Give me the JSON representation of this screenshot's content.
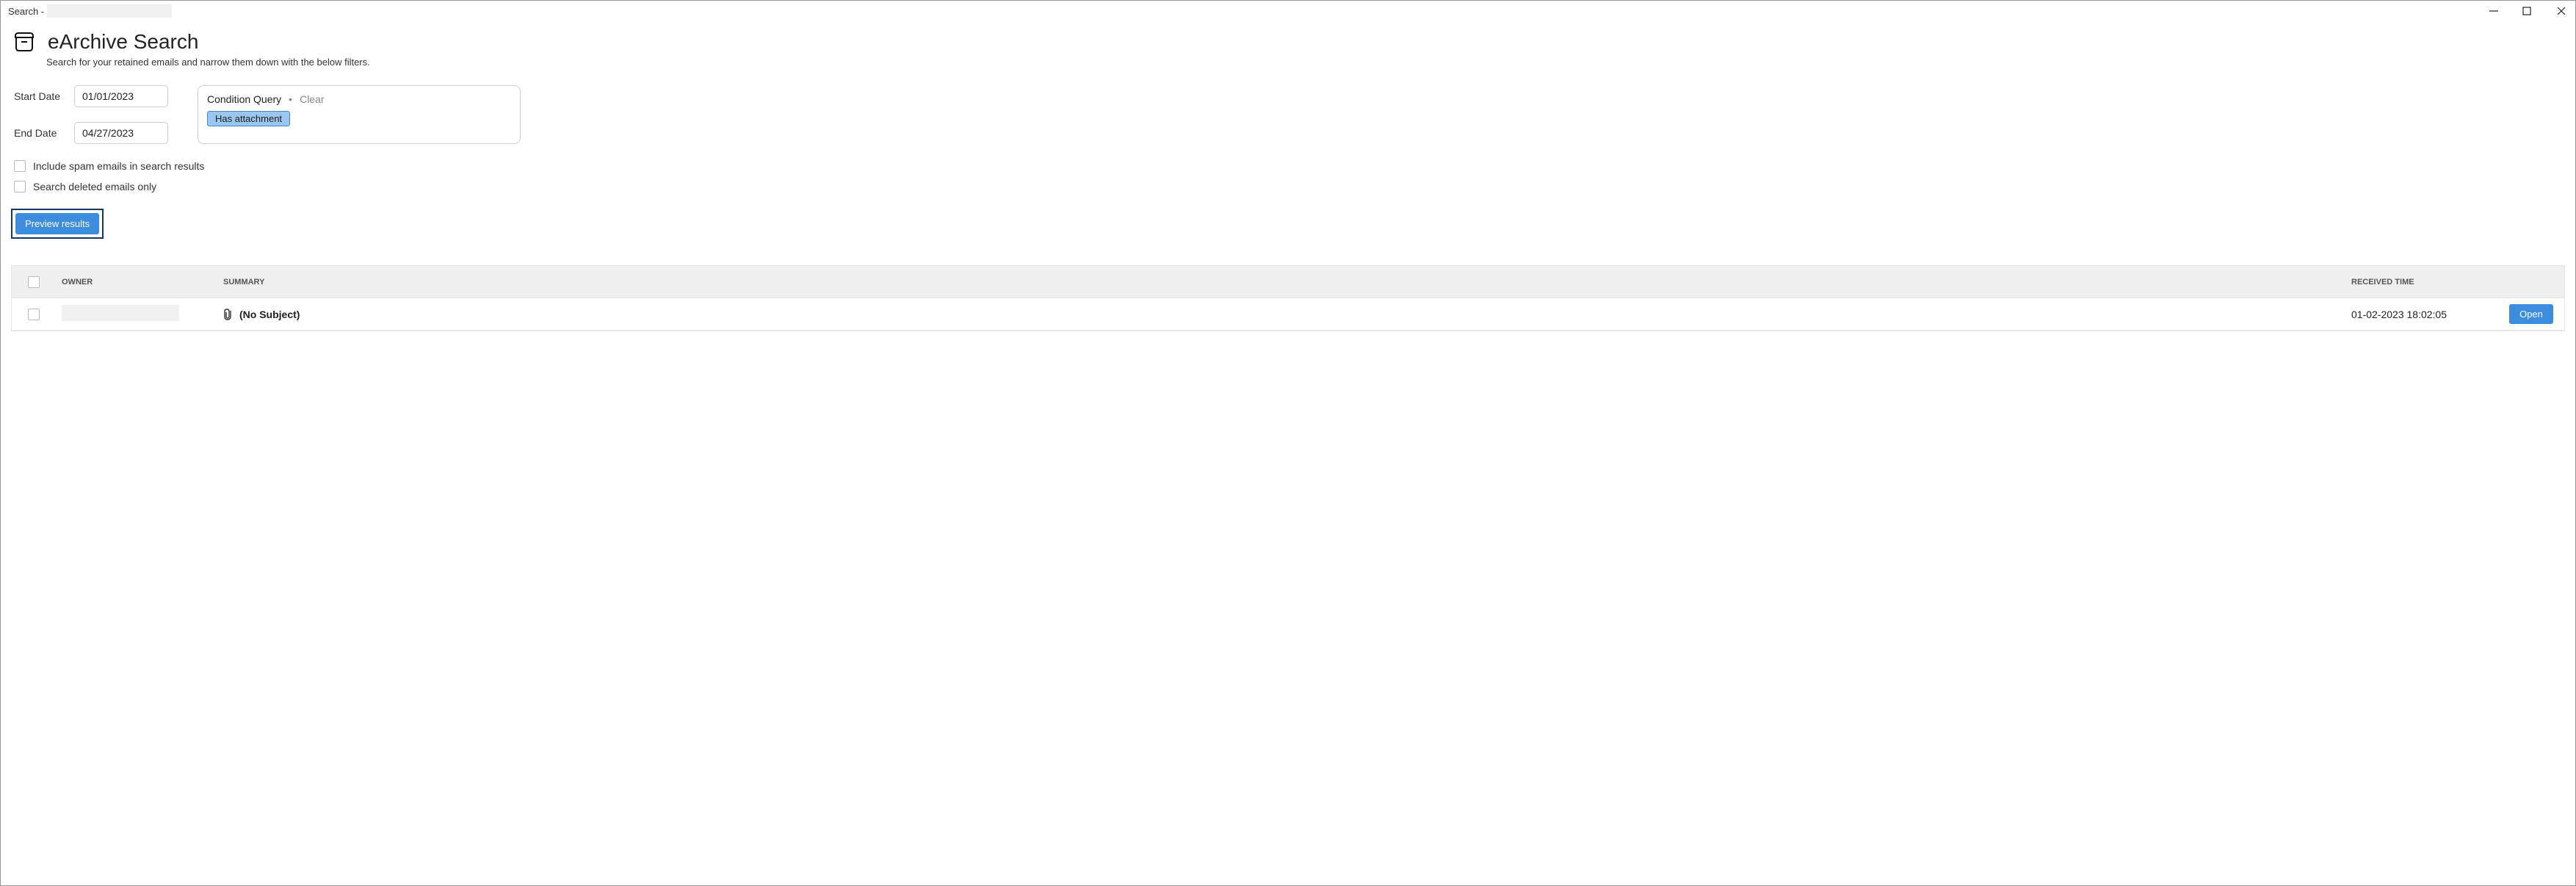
{
  "window": {
    "title_prefix": "Search -"
  },
  "header": {
    "title": "eArchive Search",
    "subtitle": "Search for your retained emails and narrow them down with the below filters."
  },
  "filters": {
    "start_date_label": "Start Date",
    "start_date_value": "01/01/2023",
    "end_date_label": "End Date",
    "end_date_value": "04/27/2023",
    "condition_query_label": "Condition Query",
    "clear_label": "Clear",
    "chip_label": "Has attachment"
  },
  "checks": {
    "include_spam": "Include spam emails in search results",
    "search_deleted": "Search deleted emails only"
  },
  "buttons": {
    "preview": "Preview results",
    "open": "Open"
  },
  "table": {
    "headers": {
      "owner": "Owner",
      "summary": "Summary",
      "received": "Received Time"
    },
    "rows": [
      {
        "summary": "(No Subject)",
        "received": "01-02-2023 18:02:05"
      }
    ]
  }
}
